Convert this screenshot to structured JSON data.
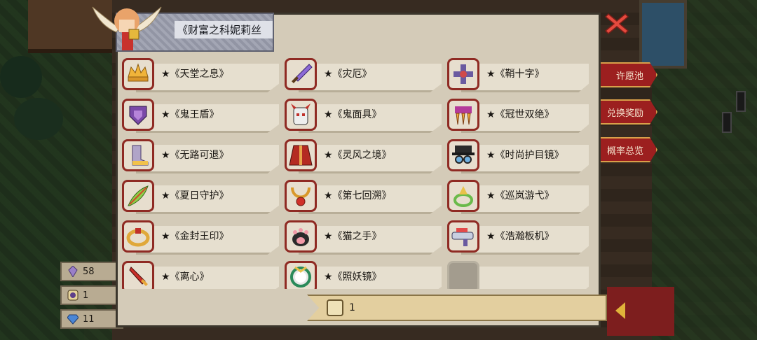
{
  "background": {
    "left_currencies": [
      {
        "icon": "crystal-icon",
        "value": "58"
      },
      {
        "icon": "token-icon",
        "value": "1"
      },
      {
        "icon": "gem-icon",
        "value": "11"
      }
    ],
    "side_buttons": [
      "许愿池",
      "兑换奖励",
      "概率总览"
    ]
  },
  "header": {
    "character_title": "《财富之科妮莉丝"
  },
  "items": [
    {
      "name": "★《天堂之息》",
      "icon": "crown-icon"
    },
    {
      "name": "★《灾厄》",
      "icon": "sword-icon"
    },
    {
      "name": "★《鞘十字》",
      "icon": "cross-icon"
    },
    {
      "name": "★《鬼王盾》",
      "icon": "shield-icon"
    },
    {
      "name": "★《鬼面具》",
      "icon": "mask-icon"
    },
    {
      "name": "★《冠世双绝》",
      "icon": "claw-icon"
    },
    {
      "name": "★《无路可退》",
      "icon": "boots-icon"
    },
    {
      "name": "★《灵风之境》",
      "icon": "cloak-icon"
    },
    {
      "name": "★《时尚护目镜》",
      "icon": "goggles-hat-icon"
    },
    {
      "name": "★《夏日守护》",
      "icon": "feather-icon"
    },
    {
      "name": "★《第七回溯》",
      "icon": "necklace-icon"
    },
    {
      "name": "★《巡岚游弋》",
      "icon": "ring-icon"
    },
    {
      "name": "★《金封王印》",
      "icon": "gold-ring-icon"
    },
    {
      "name": "★《猫之手》",
      "icon": "cat-paw-icon"
    },
    {
      "name": "★《浩瀚板机》",
      "icon": "gun-icon"
    },
    {
      "name": "★《离心》",
      "icon": "dagger-icon"
    },
    {
      "name": "★《照妖镜》",
      "icon": "mirror-icon"
    },
    {
      "name": "",
      "icon": "empty-slot"
    }
  ],
  "footer": {
    "counter_value": "1"
  },
  "colors": {
    "panel_bg": "#d4cbb8",
    "item_border": "#8f2a23",
    "side_button": "#9c1f1f",
    "counter_bg": "#e3cf9f"
  }
}
